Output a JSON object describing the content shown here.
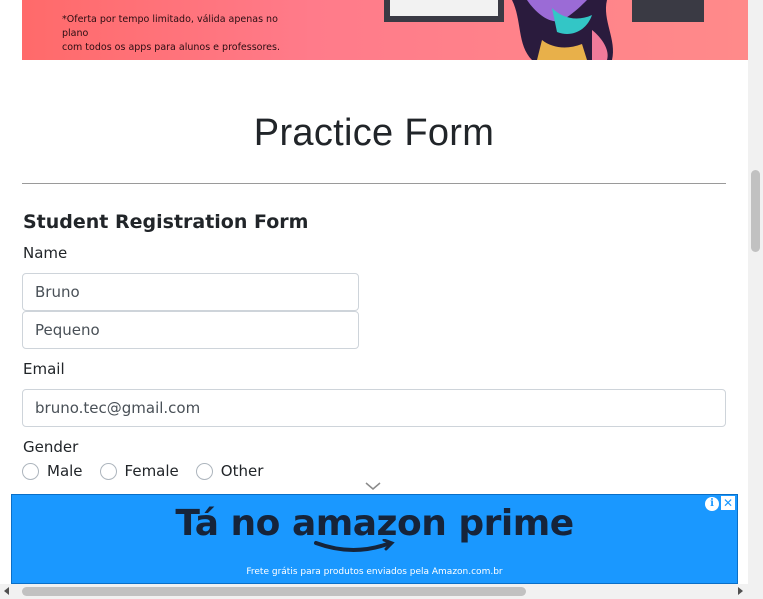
{
  "promo": {
    "line1": "*Oferta por tempo limitado, válida apenas no plano",
    "line2": "com todos os apps para alunos e professores."
  },
  "page": {
    "title": "Practice Form",
    "form_heading": "Student Registration Form"
  },
  "form": {
    "name_label": "Name",
    "first_name_value": "Bruno",
    "last_name_value": "Pequeno",
    "email_label": "Email",
    "email_value": "bruno.tec@gmail.com",
    "gender_label": "Gender",
    "gender_options": [
      "Male",
      "Female",
      "Other"
    ]
  },
  "ad": {
    "headline": "Tá no amazon prime",
    "subtext": "Frete grátis para produtos enviados pela Amazon.com.br",
    "info_icon": "info-icon",
    "close_icon": "close-icon",
    "background_color": "#1a98ff"
  },
  "colors": {
    "promo_bg": "#ff7b8a",
    "border": "#ced4da",
    "text": "#212529"
  }
}
